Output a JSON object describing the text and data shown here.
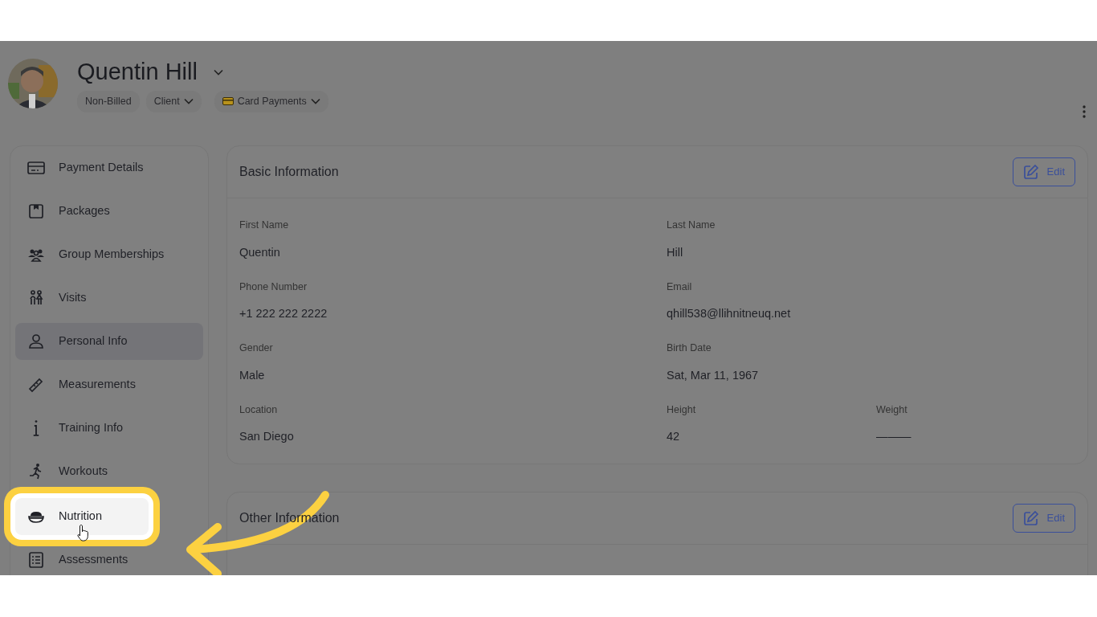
{
  "profile": {
    "name": "Quentin Hill",
    "tags": [
      {
        "label": "Non-Billed",
        "dropdown": false,
        "card": false
      },
      {
        "label": "Client",
        "dropdown": true,
        "card": false
      },
      {
        "label": "Card Payments",
        "dropdown": true,
        "card": true
      }
    ]
  },
  "sidebar": {
    "items": [
      {
        "label": "Payment Details",
        "selected": false,
        "highlighted": false
      },
      {
        "label": "Packages",
        "selected": false,
        "highlighted": false
      },
      {
        "label": "Group Memberships",
        "selected": false,
        "highlighted": false
      },
      {
        "label": "Visits",
        "selected": false,
        "highlighted": false
      },
      {
        "label": "Personal Info",
        "selected": true,
        "highlighted": false
      },
      {
        "label": "Measurements",
        "selected": false,
        "highlighted": false
      },
      {
        "label": "Training Info",
        "selected": false,
        "highlighted": false
      },
      {
        "label": "Workouts",
        "selected": false,
        "highlighted": false
      },
      {
        "label": "Nutrition",
        "selected": false,
        "highlighted": true
      },
      {
        "label": "Assessments",
        "selected": false,
        "highlighted": false
      }
    ]
  },
  "sections": [
    {
      "title": "Basic Information",
      "edit_button": "Edit",
      "rows": [
        [
          {
            "label": "First Name",
            "value": "Quentin"
          },
          {
            "label": "Last Name",
            "value": "Hill"
          }
        ],
        [
          {
            "label": "Phone Number",
            "value": "+1 222 222 2222"
          },
          {
            "label": "Email",
            "value": "qhill538@llihnitneuq.net"
          }
        ],
        [
          {
            "label": "Gender",
            "value": "Male"
          },
          {
            "label": "Birth Date",
            "value": "Sat, Mar 11, 1967"
          }
        ],
        [
          {
            "label": "Location",
            "value": "San Diego"
          },
          {
            "label": "Height",
            "value": "42"
          },
          {
            "label": "Weight",
            "value": "———"
          }
        ]
      ]
    },
    {
      "title": "Other Information",
      "edit_button": "Edit"
    }
  ]
}
